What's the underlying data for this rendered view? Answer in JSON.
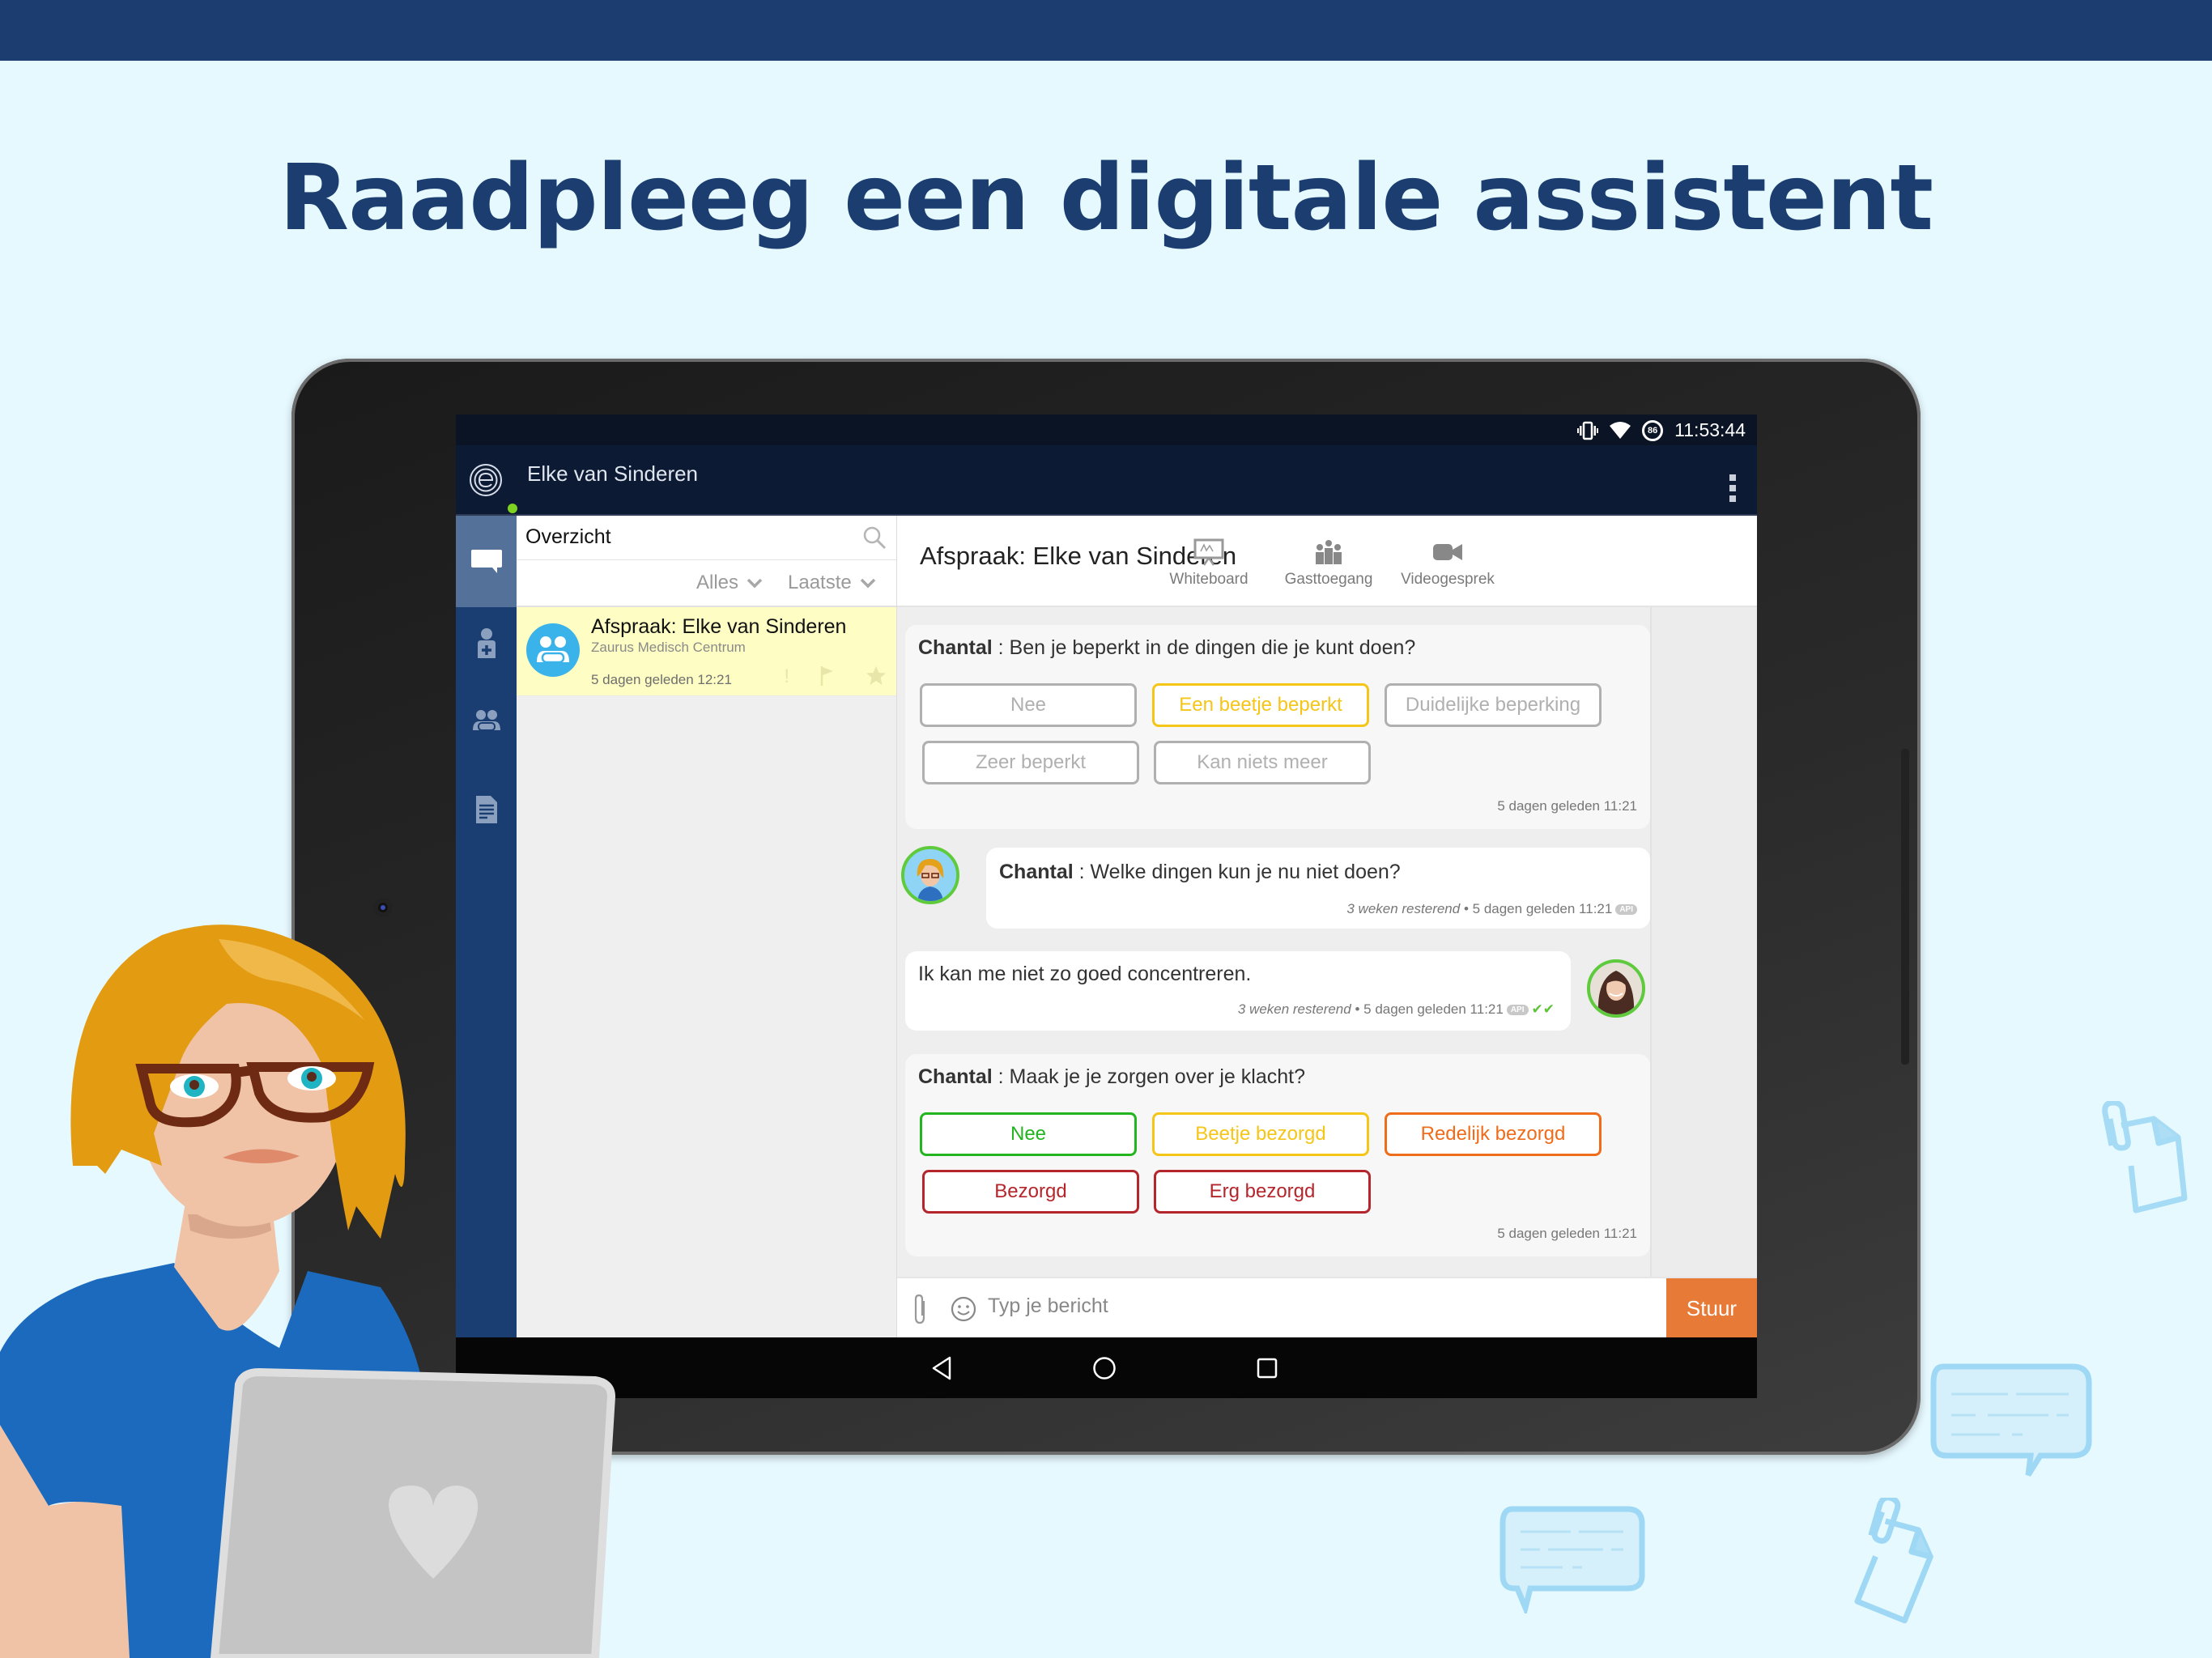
{
  "headline": "Raadpleeg een digitale assistent",
  "colors": {
    "banner": "#1b3d70",
    "background": "#e6f9ff",
    "rail": "#1b3e72",
    "rail_active": "#54719a",
    "selected_conversation": "#fdfdc4",
    "send_button": "#e77a37",
    "online": "#7ed321"
  },
  "status_bar": {
    "icons": [
      "vibrate-icon",
      "wifi-icon",
      "battery-saver-icon"
    ],
    "battery_level": "86",
    "time": "11:53:44"
  },
  "app_bar": {
    "user_name": "Elke van Sinderen",
    "logo_icon": "e-logo-icon",
    "menu_icon": "more-vert-icon"
  },
  "rail": {
    "items": [
      {
        "icon": "chat-icon",
        "active": true
      },
      {
        "icon": "doctor-icon",
        "active": false
      },
      {
        "icon": "group-icon",
        "active": false
      },
      {
        "icon": "document-icon",
        "active": false
      }
    ]
  },
  "list": {
    "title": "Overzicht",
    "filters": [
      {
        "label": "Alles"
      },
      {
        "label": "Laatste"
      }
    ],
    "conversations": [
      {
        "title": "Afspraak: Elke van Sinderen",
        "subtitle": "Zaurus Medisch Centrum",
        "time": "5 dagen geleden 12:21",
        "selected": true
      }
    ]
  },
  "chat": {
    "title": "Afspraak: Elke van Sinderen",
    "tools": [
      {
        "label": "Whiteboard",
        "icon": "whiteboard-icon"
      },
      {
        "label": "Gasttoegang",
        "icon": "guest-access-icon"
      },
      {
        "label": "Videogesprek",
        "icon": "video-call-icon"
      }
    ],
    "messages": [
      {
        "type": "question",
        "sender": "Chantal",
        "separator": " : ",
        "text": "Ben je beperkt in de dingen die je kunt doen?",
        "options": [
          {
            "label": "Nee",
            "color": "#b0b0b0",
            "selected": false
          },
          {
            "label": "Een beetje beperkt",
            "color": "#f5c518",
            "selected": true
          },
          {
            "label": "Duidelijke beperking",
            "color": "#b0b0b0",
            "selected": false
          },
          {
            "label": "Zeer beperkt",
            "color": "#b0b0b0",
            "selected": false
          },
          {
            "label": "Kan niets meer",
            "color": "#b0b0b0",
            "selected": false
          }
        ],
        "timestamp": "5 dagen geleden 11:21"
      },
      {
        "type": "incoming",
        "sender": "Chantal",
        "separator": " : ",
        "text": "Welke dingen kun je nu niet doen?",
        "remaining": "3 weken resterend",
        "timestamp": "5 dagen geleden 11:21",
        "badge": "API"
      },
      {
        "type": "outgoing",
        "text": "Ik kan me niet zo goed concentreren.",
        "remaining": "3 weken resterend",
        "timestamp": "5 dagen geleden 11:21",
        "badge": "API",
        "read_receipt": "✔✔"
      },
      {
        "type": "question",
        "sender": "Chantal",
        "separator": " : ",
        "text": "Maak je je zorgen over je klacht?",
        "options": [
          {
            "label": "Nee",
            "color": "#22b51f",
            "selected": false
          },
          {
            "label": "Beetje bezorgd",
            "color": "#f5c518",
            "selected": false
          },
          {
            "label": "Redelijk bezorgd",
            "color": "#ee6c1a",
            "selected": false
          },
          {
            "label": "Bezorgd",
            "color": "#b5262c",
            "selected": false
          },
          {
            "label": "Erg bezorgd",
            "color": "#b5262c",
            "selected": false
          }
        ],
        "timestamp": "5 dagen geleden 11:21"
      }
    ]
  },
  "composer": {
    "placeholder": "Typ je bericht",
    "value": "",
    "send_label": "Stuur"
  },
  "nav": {
    "back_icon": "back-icon",
    "home_icon": "home-icon",
    "recents_icon": "recents-icon"
  }
}
